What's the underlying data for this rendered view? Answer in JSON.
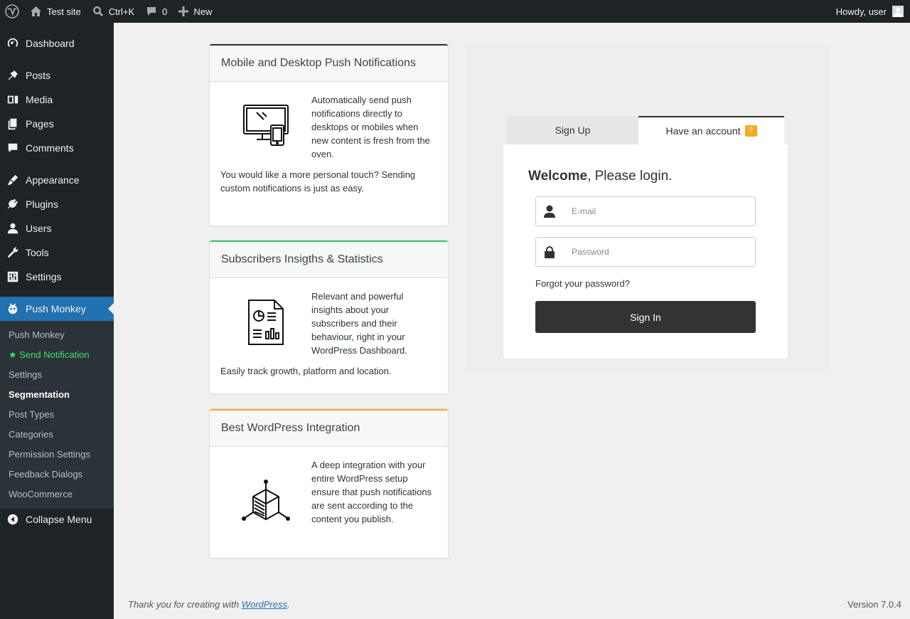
{
  "adminbar": {
    "site_name": "Test site",
    "search_shortcut": "Ctrl+K",
    "comments_count": "0",
    "new_label": "New",
    "greeting": "Howdy, user"
  },
  "sidebar": {
    "items": [
      {
        "label": "Dashboard",
        "icon": "dashboard-icon"
      },
      {
        "label": "Posts",
        "icon": "pin-icon"
      },
      {
        "label": "Media",
        "icon": "media-icon"
      },
      {
        "label": "Pages",
        "icon": "pages-icon"
      },
      {
        "label": "Comments",
        "icon": "comment-icon"
      },
      {
        "label": "Appearance",
        "icon": "brush-icon"
      },
      {
        "label": "Plugins",
        "icon": "plug-icon"
      },
      {
        "label": "Users",
        "icon": "user-icon"
      },
      {
        "label": "Tools",
        "icon": "wrench-icon"
      },
      {
        "label": "Settings",
        "icon": "sliders-icon"
      },
      {
        "label": "Push Monkey",
        "icon": "monkey-icon"
      }
    ],
    "submenu": [
      "Push Monkey",
      "★ Send Notification",
      "Settings",
      "Segmentation",
      "Post Types",
      "Categories",
      "Permission Settings",
      "Feedback Dialogs",
      "WooCommerce"
    ],
    "collapse_label": "Collapse Menu"
  },
  "cards": [
    {
      "title": "Mobile and Desktop Push Notifications",
      "accent": "#333333",
      "p1": "Automatically send push notifications directly to desktops or mobiles when new content is fresh from the oven.",
      "p2": "You would like a more personal touch? Sending custom notifications is just as easy."
    },
    {
      "title": "Subscribers Insigths & Statistics",
      "accent": "#39c26b",
      "p1": "Relevant and powerful insights about your subscribers and their behaviour, right in your WordPress Dashboard.",
      "p2": "Easily track growth, platform and location."
    },
    {
      "title": "Best WordPress Integration",
      "accent": "#f7a823",
      "p1": "A deep integration with your entire WordPress setup ensure that push notifications are sent according to the content you publish.",
      "p2": ""
    }
  ],
  "login": {
    "tab_signup": "Sign Up",
    "tab_have_account": "Have an account",
    "badge": "?",
    "welcome_bold": "Welcome",
    "welcome_rest": ", Please login.",
    "email_placeholder": "E-mail",
    "password_placeholder": "Password",
    "forgot": "Forgot your password?",
    "signin": "Sign In"
  },
  "footer": {
    "thanks_prefix": "Thank you for creating with ",
    "thanks_link": "WordPress",
    "thanks_suffix": ".",
    "version": "Version 7.0.4"
  },
  "colors": {
    "adminbar_bg": "#1d2327",
    "active_menu": "#2271b1",
    "badge": "#f7a823",
    "button": "#333333"
  }
}
